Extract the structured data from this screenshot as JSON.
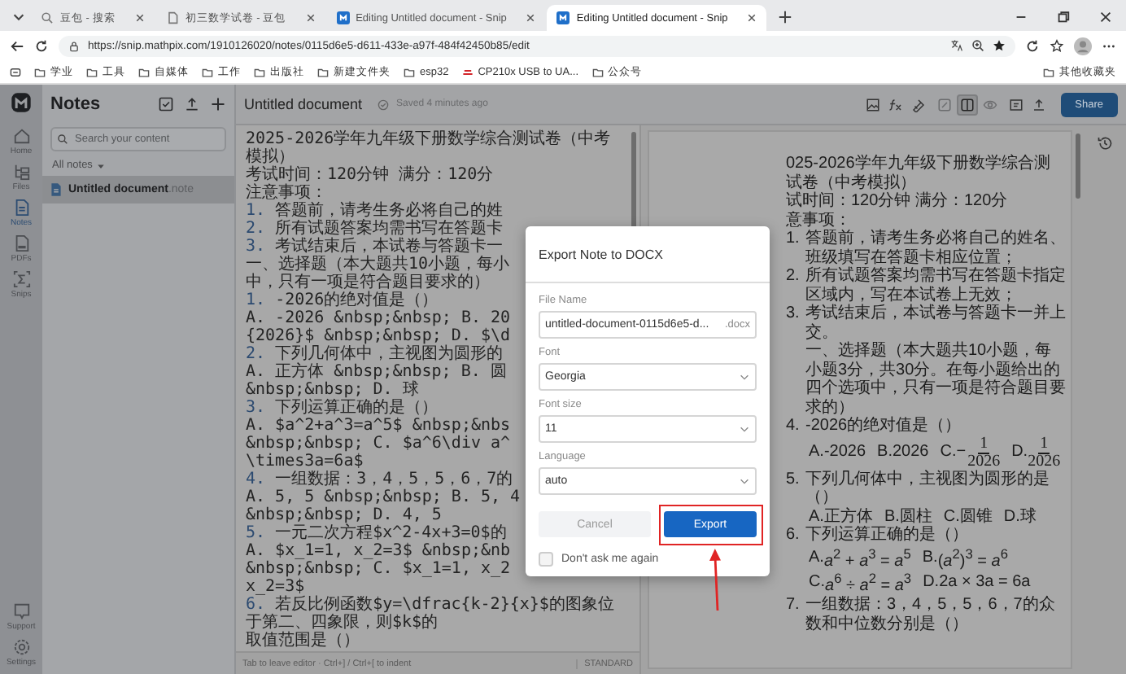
{
  "browser": {
    "tabs": [
      {
        "title": "豆包 - 搜索",
        "kind": "search",
        "selected": false
      },
      {
        "title": "初三数学试卷 - 豆包",
        "kind": "doc",
        "selected": false
      },
      {
        "title": "Editing Untitled document - Snip",
        "kind": "app",
        "selected": false
      },
      {
        "title": "Editing Untitled document - Snip",
        "kind": "app",
        "selected": true
      }
    ],
    "url": "https://snip.mathpix.com/1910126020/notes/0115d6e5-d611-433e-a97f-484f42450b85/edit",
    "bookmarks": [
      {
        "label": "学业",
        "kind": "folder"
      },
      {
        "label": "工具",
        "kind": "folder"
      },
      {
        "label": "自媒体",
        "kind": "folder"
      },
      {
        "label": "工作",
        "kind": "folder"
      },
      {
        "label": "出版社",
        "kind": "folder"
      },
      {
        "label": "新建文件夹",
        "kind": "folder"
      },
      {
        "label": "esp32",
        "kind": "folder"
      },
      {
        "label": "CP210x USB to UA...",
        "kind": "site"
      },
      {
        "label": "公众号",
        "kind": "folder"
      }
    ],
    "other_bookmarks": "其他收藏夹"
  },
  "rail": {
    "items": [
      {
        "label": "Home",
        "kind": "home",
        "selected": false
      },
      {
        "label": "Files",
        "kind": "files",
        "selected": false
      },
      {
        "label": "Notes",
        "kind": "notes",
        "selected": true
      },
      {
        "label": "PDFs",
        "kind": "pdf",
        "selected": false
      },
      {
        "label": "Snips",
        "kind": "snip",
        "selected": false
      }
    ],
    "bottom": [
      {
        "label": "Support",
        "kind": "support"
      },
      {
        "label": "Settings",
        "kind": "settings"
      }
    ]
  },
  "notes": {
    "title": "Notes",
    "search": {
      "placeholder": "Search your content"
    },
    "filter": "All notes",
    "items": [
      {
        "name": "**Untitled document**.note",
        "selected": true
      }
    ]
  },
  "editor": {
    "title": "Untitled document",
    "saved": "Saved 4 minutes ago",
    "lines": [
      {
        "text": "2025-2026学年九年级下册数学综合测试卷（中考模拟）"
      },
      {
        "text": "考试时间：120分钟 满分：120分"
      },
      {
        "text": "注意事项："
      },
      {
        "num": "1.",
        "text": "答题前，请考生务必将自己的姓"
      },
      {
        "num": "2.",
        "text": "所有试题答案均需书写在答题卡"
      },
      {
        "num": "3.",
        "text": "考试结束后，本试卷与答题卡一"
      },
      {
        "text": "一、选择题（本大题共10小题，每小"
      },
      {
        "text": "中，只有一项是符合题目要求的）"
      },
      {
        "num": "1.",
        "text": "-2026的绝对值是（）"
      },
      {
        "text": "A. -2026 &nbsp;&nbsp; B. 20"
      },
      {
        "text": "{2026}$ &nbsp;&nbsp; D. $\\d"
      },
      {
        "num": "2.",
        "text": "下列几何体中，主视图为圆形的"
      },
      {
        "text": "A. 正方体 &nbsp;&nbsp; B. 圆"
      },
      {
        "text": "&nbsp;&nbsp; D. 球"
      },
      {
        "num": "3.",
        "text": "下列运算正确的是（）"
      },
      {
        "text": "A. $a^2+a^3=a^5$ &nbsp;&nbs"
      },
      {
        "text": "&nbsp;&nbsp; C. $a^6\\div a^"
      },
      {
        "text": "\\times3a=6a$"
      },
      {
        "num": "4.",
        "text": "一组数据：3，4，5，5，6，7的"
      },
      {
        "text": "A. 5, 5 &nbsp;&nbsp; B. 5, 4"
      },
      {
        "text": "&nbsp;&nbsp; D. 4, 5"
      },
      {
        "num": "5.",
        "text": "一元二次方程$x^2-4x+3=0$的"
      },
      {
        "text": "A. $x_1=1, x_2=3$ &nbsp;&nb"
      },
      {
        "text": "&nbsp;&nbsp; C. $x_1=1, x_2"
      },
      {
        "text": "x_2=3$"
      },
      {
        "num": "6.",
        "text": "若反比例函数$y=\\dfrac{k-2}{x}$的图象位于第二、四象限，则$k$的"
      },
      {
        "text": "取值范围是（）"
      }
    ],
    "status": "Tab to leave editor · Ctrl+] / Ctrl+[ to indent",
    "mode": "STANDARD"
  },
  "toolbar": {
    "tools": [
      {
        "kind": "image"
      },
      {
        "kind": "formula"
      },
      {
        "kind": "chem"
      }
    ],
    "view_modes": [
      {
        "kind": "edit",
        "selected": false
      },
      {
        "kind": "split",
        "selected": true
      },
      {
        "kind": "preview",
        "selected": false
      }
    ],
    "actions": [
      {
        "kind": "export"
      },
      {
        "kind": "upload"
      }
    ],
    "share": "Share"
  },
  "preview": {
    "heading": [
      "025-2026学年九年级下册数学综合测试卷（中考模拟）",
      "试时间：120分钟 满分：120分",
      "意事项："
    ],
    "items": [
      {
        "num": "1.",
        "text": "答题前，请考生务必将自己的姓名、班级填写在答题卡相应位置；"
      },
      {
        "num": "2.",
        "text": "所有试题答案均需书写在答题卡指定区域内，写在本试卷上无效；"
      },
      {
        "num": "3.",
        "text": "考试结束后，本试卷与答题卡一并上交。",
        "extra": "一、选择题（本大题共10小题，每小题3分，共30分。在每小题给出的四个选项中，只有一项是符合题目要求的）"
      },
      {
        "num": "4.",
        "text": "-2026的绝对值是（）",
        "options": [
          {
            "kind": "text",
            "label": "A.",
            "text": "-2026"
          },
          {
            "kind": "text",
            "label": "B.",
            "text": "2026"
          },
          {
            "kind": "fraction",
            "label": "C.",
            "sign": "−",
            "num": "1",
            "den": "2026"
          },
          {
            "kind": "fraction",
            "label": "D.",
            "num": "1",
            "den": "2026"
          }
        ]
      },
      {
        "num": "5.",
        "text": "下列几何体中，主视图为圆形的是（）",
        "options": [
          {
            "kind": "text",
            "label": "A.",
            "text": "正方体"
          },
          {
            "kind": "text",
            "label": "B.",
            "text": "圆柱"
          },
          {
            "kind": "text",
            "label": "C.",
            "text": "圆锥"
          },
          {
            "kind": "text",
            "label": "D.",
            "text": "球"
          }
        ]
      },
      {
        "num": "6.",
        "text": "下列运算正确的是（）",
        "options": [
          {
            "kind": "text",
            "label": "A.",
            "text": "*a*$^{2}$ + *a*$^{3}$ = *a*$^{5}$"
          },
          {
            "kind": "text",
            "label": "B.",
            "text": "(*a*$^{2}$)$^{3}$ = *a*$^{6}$"
          },
          {
            "kind": "text",
            "label": "C.",
            "text": "*a*$^{6}$ ÷ *a*$^{2}$ = *a*$^{3}$"
          },
          {
            "kind": "text",
            "label": "D.",
            "text": "2a × 3a = 6a"
          }
        ]
      },
      {
        "num": "7.",
        "text": "一组数据：3，4，5，5，6，7的众数和中位数分别是（）"
      }
    ]
  },
  "dialog": {
    "title": "Export Note to DOCX",
    "fields": [
      {
        "label": "File Name",
        "kind": "text",
        "value": "untitled-document-0115d6e5-d...",
        "suffix": ".docx"
      },
      {
        "label": "Font",
        "kind": "select",
        "value": "Georgia"
      },
      {
        "label": "Font size",
        "kind": "select",
        "value": "11"
      },
      {
        "label": "Language",
        "kind": "select",
        "value": "auto"
      }
    ],
    "cancel": "Cancel",
    "export": "Export",
    "highlighted": true,
    "dont_ask": {
      "label": "Don't ask me again",
      "checked": false
    }
  }
}
